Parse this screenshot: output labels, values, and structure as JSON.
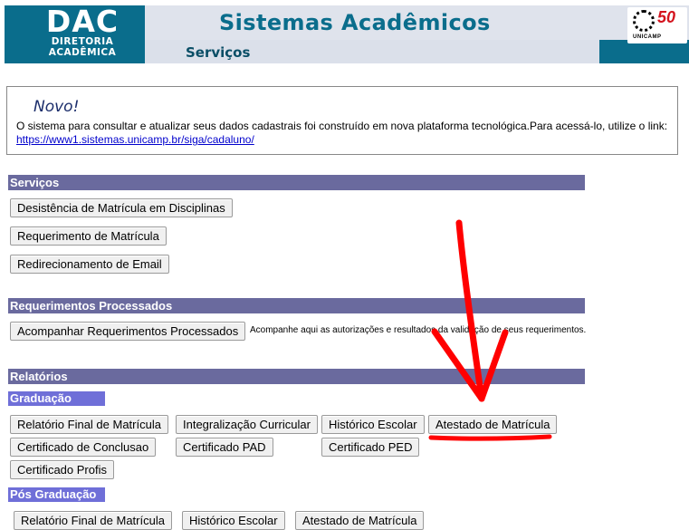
{
  "header": {
    "logo_main": "DAC",
    "logo_line1": "DIRETORIA",
    "logo_line2": "ACADÊMICA",
    "app_title": "Sistemas Acadêmicos",
    "page_title": "Serviços",
    "university_badge": "50",
    "university_name": "UNICAMP"
  },
  "notice": {
    "title": "Novo!",
    "text": "O sistema para consultar e atualizar seus dados cadastrais foi construído em nova plataforma tecnológica.Para acessá-lo, utilize o link:",
    "link": "https://www1.sistemas.unicamp.br/siga/cadaluno/"
  },
  "servicos": {
    "heading": "Serviços",
    "buttons": [
      "Desistência de Matrícula em Disciplinas",
      "Requerimento de Matrícula",
      "Redirecionamento de Email"
    ]
  },
  "requerimentos": {
    "heading": "Requerimentos Processados",
    "button": "Acompanhar Requerimentos Processados",
    "hint": "Acompanhe aqui as autorizações e resultados da validação de seus requerimentos."
  },
  "relatorios": {
    "heading": "Relatórios",
    "graduacao": {
      "heading": "Graduação",
      "buttons": [
        "Relatório Final de Matrícula",
        "Integralização Curricular",
        "Histórico Escolar",
        "Atestado de Matrícula",
        "Certificado de Conclusao",
        "Certificado PAD",
        "Certificado PED",
        "Certificado Profis"
      ]
    },
    "pos_graduacao": {
      "heading": "Pós Graduação",
      "buttons": [
        "Relatório Final de Matrícula",
        "Histórico Escolar",
        "Atestado de Matrícula"
      ]
    }
  },
  "annotation": {
    "arrow_color": "#ff0000"
  },
  "colors": {
    "header": "#0a6d8c",
    "section_bar": "#6a6a9e",
    "subsection_bar": "#6f6fd8"
  }
}
